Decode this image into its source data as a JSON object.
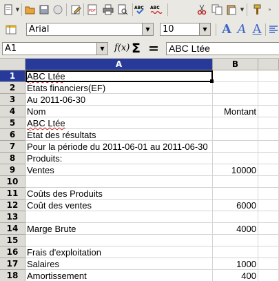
{
  "toolbar_standard": {
    "icons": [
      "new-icon",
      "open-icon",
      "save-icon",
      "mail-icon",
      "edit-icon",
      "pdf-icon",
      "print-icon",
      "print-preview-icon",
      "spellcheck-icon",
      "autospell-icon",
      "cut-icon",
      "copy-icon",
      "paste-icon",
      "format-paintbrush-icon"
    ]
  },
  "toolbar_formatting": {
    "font_name": "Arial",
    "font_size": "10",
    "bold_label": "A",
    "italic_label": "A",
    "underline_label": "A"
  },
  "formula_bar": {
    "name_box": "A1",
    "function_label": "f(x)",
    "sum_label": "Σ",
    "equals_label": "=",
    "content": "ABC Ltée"
  },
  "columns": [
    "A",
    "B"
  ],
  "rows": [
    {
      "n": "1",
      "a": "ABC Ltée",
      "b": ""
    },
    {
      "n": "2",
      "a": "États financiers(EF)",
      "b": ""
    },
    {
      "n": "3",
      "a": "Au 2011-06-30",
      "b": ""
    },
    {
      "n": "4",
      "a": "Nom",
      "b": "Montant"
    },
    {
      "n": "5",
      "a": "ABC Ltée",
      "b": ""
    },
    {
      "n": "6",
      "a": "État des résultats",
      "b": ""
    },
    {
      "n": "7",
      "a": "Pour la période du 2011-06-01 au 2011-06-30",
      "b": ""
    },
    {
      "n": "8",
      "a": "Produits:",
      "b": ""
    },
    {
      "n": "9",
      "a": "Ventes",
      "b": "10000"
    },
    {
      "n": "10",
      "a": "",
      "b": ""
    },
    {
      "n": "11",
      "a": "Coûts des Produits",
      "b": ""
    },
    {
      "n": "12",
      "a": "Coût des ventes",
      "b": "6000"
    },
    {
      "n": "13",
      "a": "",
      "b": ""
    },
    {
      "n": "14",
      "a": "Marge Brute",
      "b": "4000"
    },
    {
      "n": "15",
      "a": "",
      "b": ""
    },
    {
      "n": "16",
      "a": "Frais d'exploitation",
      "b": ""
    },
    {
      "n": "17",
      "a": "Salaires",
      "b": "1000"
    },
    {
      "n": "18",
      "a": "Amortissement",
      "b": "400"
    }
  ],
  "colors": {
    "selection_header": "#283a99",
    "accent_blue": "#3d66c6"
  }
}
